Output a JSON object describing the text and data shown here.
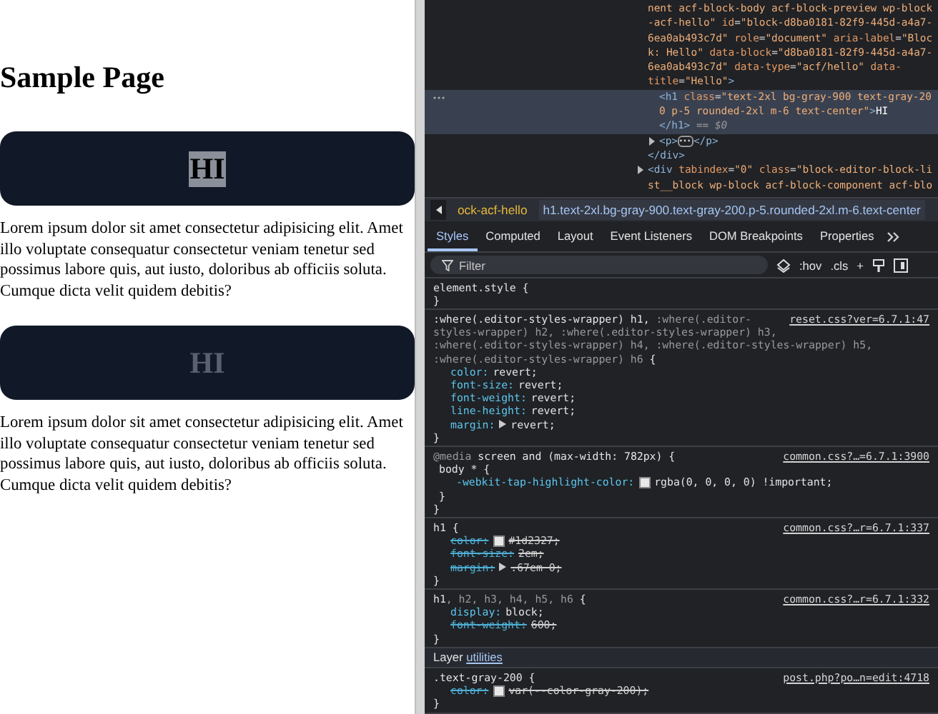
{
  "page": {
    "title": "Sample Page",
    "blocks": [
      {
        "heading": "HI",
        "highlighted": true,
        "paragraph": "Lorem ipsum dolor sit amet consectetur adipisicing elit. Amet illo voluptate consequatur consectetur veniam tenetur sed possimus labore quis, aut iusto, doloribus ab officiis soluta. Cumque dicta velit quidem debitis?"
      },
      {
        "heading": "HI",
        "highlighted": false,
        "paragraph": "Lorem ipsum dolor sit amet consectetur adipisicing elit. Amet illo voluptate consequatur consectetur veniam tenetur sed possimus labore quis, aut iusto, doloribus ab officiis soluta. Cumque dicta velit quidem debitis?"
      }
    ]
  },
  "dom": {
    "nodes": [
      {
        "selected": false,
        "lines": [
          [
            {
              "kind": "value",
              "text": "nent acf-block-body acf-block-preview wp-block"
            }
          ],
          [
            {
              "kind": "value",
              "text": "-acf-hello\""
            },
            {
              "kind": "attr",
              "text": " id"
            },
            {
              "kind": "punct",
              "text": "="
            },
            {
              "kind": "value",
              "text": "\"block-d8ba0181-82f9-445d-a4a7-"
            }
          ],
          [
            {
              "kind": "value",
              "text": "6ea0ab493c7d\""
            },
            {
              "kind": "attr",
              "text": " role"
            },
            {
              "kind": "punct",
              "text": "="
            },
            {
              "kind": "value",
              "text": "\"document\""
            },
            {
              "kind": "attr",
              "text": " aria-label"
            },
            {
              "kind": "punct",
              "text": "="
            },
            {
              "kind": "value",
              "text": "\"Bloc"
            }
          ],
          [
            {
              "kind": "value",
              "text": "k: Hello\""
            },
            {
              "kind": "attr",
              "text": " data-block"
            },
            {
              "kind": "punct",
              "text": "="
            },
            {
              "kind": "value",
              "text": "\"d8ba0181-82f9-445d-a4a7-"
            }
          ],
          [
            {
              "kind": "value",
              "text": "6ea0ab493c7d\""
            },
            {
              "kind": "attr",
              "text": " data-type"
            },
            {
              "kind": "punct",
              "text": "="
            },
            {
              "kind": "value",
              "text": "\"acf/hello\""
            },
            {
              "kind": "attr",
              "text": " data-"
            }
          ],
          [
            {
              "kind": "attr",
              "text": "title"
            },
            {
              "kind": "punct",
              "text": "="
            },
            {
              "kind": "value",
              "text": "\"Hello\""
            },
            {
              "kind": "tag",
              "text": ">"
            }
          ]
        ],
        "children": [
          {
            "selected": true,
            "lines": [
              [
                {
                  "kind": "tag",
                  "text": "<h1"
                },
                {
                  "kind": "attr",
                  "text": " class"
                },
                {
                  "kind": "punct",
                  "text": "="
                },
                {
                  "kind": "value",
                  "text": "\"text-2xl bg-gray-900 text-gray-20"
                }
              ],
              [
                {
                  "kind": "value",
                  "text": "0 p-5 rounded-2xl m-6 text-center\""
                },
                {
                  "kind": "tag",
                  "text": ">"
                },
                {
                  "kind": "text",
                  "text": "HI"
                }
              ],
              [
                {
                  "kind": "tag",
                  "text": "</h1>"
                },
                {
                  "kind": "dim",
                  "text": " == $0"
                }
              ]
            ]
          },
          {
            "selected": false,
            "expanded": false,
            "lines": [
              [
                {
                  "kind": "tag",
                  "text": "<p>"
                },
                {
                  "kind": "ellipsis"
                },
                {
                  "kind": "tag",
                  "text": "</p>"
                }
              ]
            ]
          }
        ],
        "closing": "</div>"
      },
      {
        "selected": false,
        "expanded": false,
        "lines": [
          [
            {
              "kind": "tag",
              "text": "<div"
            },
            {
              "kind": "attr",
              "text": " tabindex"
            },
            {
              "kind": "punct",
              "text": "="
            },
            {
              "kind": "value",
              "text": "\"0\""
            },
            {
              "kind": "attr",
              "text": " class"
            },
            {
              "kind": "punct",
              "text": "="
            },
            {
              "kind": "value",
              "text": "\"block-editor-block-li"
            }
          ],
          [
            {
              "kind": "value",
              "text": "st__block wp-block acf-block-component acf-blo"
            }
          ]
        ]
      }
    ]
  },
  "breadcrumbs": [
    {
      "text": "ock-acf-hello",
      "selected": false
    },
    {
      "text": "h1.text-2xl.bg-gray-900.text-gray-200.p-5.rounded-2xl.m-6.text-center",
      "selected": true
    }
  ],
  "tabs": [
    {
      "label": "Styles",
      "selected": true
    },
    {
      "label": "Computed",
      "selected": false
    },
    {
      "label": "Layout",
      "selected": false
    },
    {
      "label": "Event Listeners",
      "selected": false
    },
    {
      "label": "DOM Breakpoints",
      "selected": false
    },
    {
      "label": "Properties",
      "selected": false
    }
  ],
  "filter": {
    "placeholder": "Filter",
    "tools": [
      ":hov",
      ".cls",
      "+"
    ]
  },
  "rules": [
    {
      "kind": "rule",
      "selector": [
        [
          {
            "text": "element.style {",
            "matched": true
          }
        ]
      ],
      "close": "}"
    },
    {
      "kind": "rule",
      "source": "reset.css?ver=6.7.1:47",
      "selector": [
        [
          {
            "text": ":where(.editor-styles-wrapper) h1, ",
            "matched": true
          },
          {
            "text": ":where(.editor-",
            "matched": false
          }
        ],
        [
          {
            "text": "styles-wrapper) h2, :where(.editor-styles-wrapper) h3,",
            "matched": false
          }
        ],
        [
          {
            "text": ":where(.editor-styles-wrapper) h4, :where(.editor-styles-wrapper) h5,",
            "matched": false
          }
        ],
        [
          {
            "text": ":where(.editor-styles-wrapper) h6",
            "matched": false
          },
          {
            "text": " {",
            "matched": true
          }
        ]
      ],
      "declarations": [
        {
          "name": "color:",
          "value": "revert;",
          "overridden": false
        },
        {
          "name": "font-size:",
          "value": "revert;",
          "overridden": false
        },
        {
          "name": "font-weight:",
          "value": "revert;",
          "overridden": false
        },
        {
          "name": "line-height:",
          "value": "revert;",
          "overridden": false
        },
        {
          "name": "margin:",
          "value": "revert;",
          "overridden": false,
          "expanded": false
        }
      ],
      "close": "}"
    },
    {
      "kind": "media",
      "media": "@media",
      "query": "screen and (max-width: 782px) {",
      "source": "common.css?…=6.7.1:3900",
      "selector": [
        [
          {
            "text": "body * {",
            "matched": true
          }
        ]
      ],
      "declarations": [
        {
          "name": "-webkit-tap-highlight-color:",
          "value": "rgba(0, 0, 0, 0) !important;",
          "overridden": false,
          "swatch": true
        }
      ],
      "close": "}",
      "media_close": "}"
    },
    {
      "kind": "rule",
      "source": "common.css?…r=6.7.1:337",
      "selector": [
        [
          {
            "text": "h1 {",
            "matched": true
          }
        ]
      ],
      "declarations": [
        {
          "name": "color:",
          "value": "#1d2327;",
          "overridden": true,
          "swatch": true
        },
        {
          "name": "font-size:",
          "value": "2em;",
          "overridden": true
        },
        {
          "name": "margin:",
          "value": ".67em 0;",
          "overridden": true,
          "expanded": false
        }
      ],
      "close": "}"
    },
    {
      "kind": "rule",
      "source": "common.css?…r=6.7.1:332",
      "selector": [
        [
          {
            "text": "h1",
            "matched": true
          },
          {
            "text": ", h2, h3, h4, h5, h6",
            "matched": false
          },
          {
            "text": " {",
            "matched": true
          }
        ]
      ],
      "declarations": [
        {
          "name": "display:",
          "value": "block;",
          "overridden": false
        },
        {
          "name": "font-weight:",
          "value": "600;",
          "overridden": true
        }
      ],
      "close": "}"
    },
    {
      "kind": "layer",
      "label": "Layer",
      "link": "utilities"
    },
    {
      "kind": "rule",
      "source": "post.php?po…n=edit:4718",
      "selector": [
        [
          {
            "text": ".text-gray-200 {",
            "matched": true
          }
        ]
      ],
      "declarations": [
        {
          "name": "color:",
          "value": "var(--color-gray-200);",
          "overridden": true,
          "swatch": true
        }
      ],
      "close": "}"
    }
  ]
}
